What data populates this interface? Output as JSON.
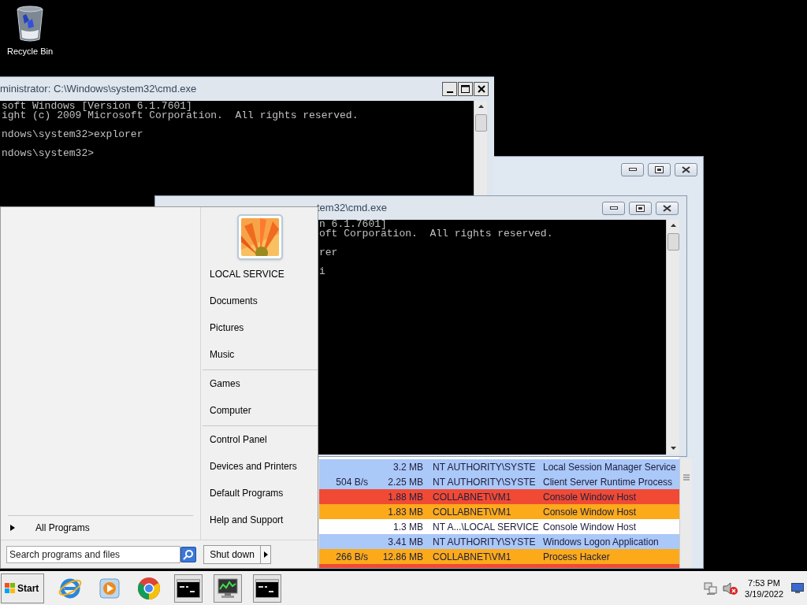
{
  "desktop": {
    "icons": [
      {
        "label": "Recycle Bin"
      }
    ]
  },
  "console_back": {
    "title": "ministrator: C:\\Windows\\system32\\cmd.exe",
    "paragraphs": [
      [
        "soft Windows [Version 6.1.7601]",
        "ight (c) 2009 Microsoft Corporation.  All rights reserved."
      ],
      [
        "ndows\\system32>explorer"
      ],
      [
        "ndows\\system32>"
      ]
    ]
  },
  "process_window": {
    "rows": [
      {
        "memory": "3.2 MB",
        "user": "NT AUTHORITY\\SYSTE",
        "description": "Local Session Manager Service",
        "color": "#aac8f8"
      },
      {
        "io": "504 B/s",
        "memory": "2.25 MB",
        "user": "NT AUTHORITY\\SYSTE",
        "description": "Client Server Runtime Process",
        "color": "#aac8f8"
      },
      {
        "memory": "1.88 MB",
        "user": "COLLABNET\\VM1",
        "description": "Console Window Host",
        "color": "#f04a35"
      },
      {
        "memory": "1.83 MB",
        "user": "COLLABNET\\VM1",
        "description": "Console Window Host",
        "color": "#fcaa1a"
      },
      {
        "memory": "1.3 MB",
        "user": "NT A...\\LOCAL SERVICE",
        "description": "Console Window Host",
        "color": "#ffffff"
      },
      {
        "memory": "3.41 MB",
        "user": "NT AUTHORITY\\SYSTE",
        "description": "Windows Logon Application",
        "color": "#aac8f8"
      },
      {
        "io": "266 B/s",
        "memory": "12.86 MB",
        "user": "COLLABNET\\VM1",
        "description": "Process Hacker",
        "color": "#fcaa1a"
      },
      {
        "color": "#f04a35"
      }
    ]
  },
  "console_front": {
    "title": "tem32\\cmd.exe",
    "paragraphs": [
      [
        "n 6.1.7601]",
        "oft Corporation.  All rights reserved."
      ],
      [
        "rer"
      ],
      [
        "i"
      ]
    ]
  },
  "start_menu": {
    "all_programs": "All Programs",
    "search": {
      "placeholder": "Search programs and files"
    },
    "shutdown": "Shut down",
    "groups": [
      {
        "items": [
          "LOCAL SERVICE",
          "Documents",
          "Pictures",
          "Music"
        ]
      },
      {
        "items": [
          "Games",
          "Computer"
        ]
      },
      {
        "items": [
          "Control Panel",
          "Devices and Printers",
          "Default Programs",
          "Help and Support"
        ]
      }
    ]
  },
  "taskbar": {
    "start": "Start",
    "buttons": [
      {
        "kind": "browser",
        "open": false
      },
      {
        "kind": "media",
        "open": false
      },
      {
        "kind": "chrome",
        "open": false
      },
      {
        "kind": "console",
        "open": true
      },
      {
        "kind": "monitor",
        "open": true
      },
      {
        "kind": "console",
        "open": true
      }
    ],
    "tray": [
      {
        "kind": "network"
      },
      {
        "kind": "volume",
        "muted": true
      }
    ],
    "clock": {
      "time": "7:53 PM",
      "date": "3/19/2022"
    }
  }
}
